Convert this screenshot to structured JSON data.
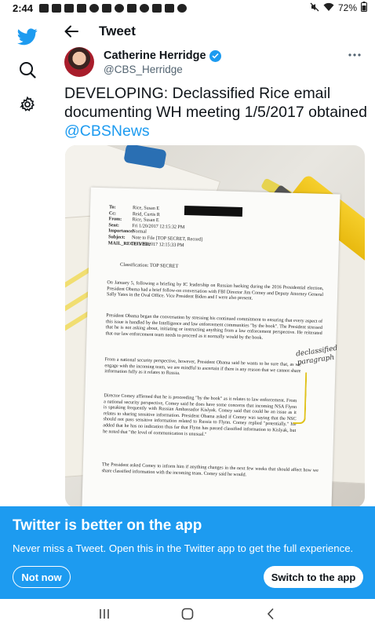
{
  "status_bar": {
    "time": "2:44",
    "battery": "72%"
  },
  "icons": {
    "logo": "twitter-bird-icon",
    "explore": "search-icon",
    "settings": "gear-icon",
    "back": "arrow-left-icon",
    "verified": "verified-badge-icon",
    "more": "more-horizontal-icon"
  },
  "colors": {
    "brand": "#1d9bf0",
    "text": "#0f1419",
    "muted": "#536471"
  },
  "header": {
    "title": "Tweet"
  },
  "tweet": {
    "author_name": "Catherine Herridge",
    "author_handle": "@CBS_Herridge",
    "text": "DEVELOPING: Declassified Rice email documenting WH meeting 1/5/2017 obtained",
    "mention": "@CBSNews",
    "photo": {
      "memo_header": [
        {
          "k": "To:",
          "v": "Rice, Susan E"
        },
        {
          "k": "Cc:",
          "v": "Reid, Curtis R"
        },
        {
          "k": "From:",
          "v": "Rice, Susan E"
        },
        {
          "k": "Sent:",
          "v": "Fri 1/20/2017 12:15:32 PM"
        },
        {
          "k": "Importance:",
          "v": "Normal"
        },
        {
          "k": "Subject:",
          "v": "Note to File [TOP SECRET, Record]"
        },
        {
          "k": "MAIL_RECEIVED:",
          "v": "Fri 1/20/2017 12:15:33 PM"
        }
      ],
      "classification": "Classification: TOP SECRET",
      "paragraphs": [
        "On January 5, following a briefing by IC leadership on Russian hacking during the 2016 Presidential election, President Obama had a brief follow-on conversation with FBI Director Jim Comey and Deputy Attorney General Sally Yates in the Oval Office. Vice President Biden and I were also present.",
        "President Obama began the conversation by stressing his continued commitment to ensuring that every aspect of this issue is handled by the Intelligence and law enforcement communities \"by the book\". The President stressed that he is not asking about, initiating or instructing anything from a law enforcement perspective. He reiterated that our law enforcement team needs to proceed as it normally would by the book.",
        "From a national security perspective, however, President Obama said he wants to be sure that, as we engage with the incoming team, we are mindful to ascertain if there is any reason that we cannot share information fully as it relates to Russia.",
        "Director Comey affirmed that he is proceeding \"by the book\" as it relates to law enforcement. From a national security perspective, Comey said he does have some concerns that incoming NSA Flynn is speaking frequently with Russian Ambassador Kislyak. Comey said that could be an issue as it relates to sharing sensitive information. President Obama asked if Comey was saying that the NSC should not pass sensitive information related to Russia to Flynn. Comey replied \"potentially.\" He added that he has no indication thus far that Flynn has passed classified information to Kislyak, but he noted that \"the level of communication is unusual.\"",
        "The President asked Comey to inform him if anything changes in the next few weeks that should affect how we share classified information with the incoming team. Comey said he would."
      ],
      "handwritten_note": "declassified paragraph"
    }
  },
  "banner": {
    "title": "Twitter is better on the app",
    "subtitle": "Never miss a Tweet. Open this in the Twitter app to get the full experience.",
    "not_now": "Not now",
    "switch": "Switch to the app"
  }
}
